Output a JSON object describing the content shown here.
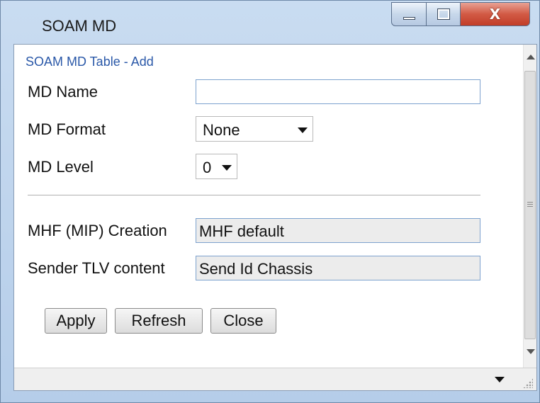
{
  "window": {
    "title": "SOAM MD",
    "controls": {
      "minimize": "minimize",
      "maximize": "maximize",
      "close": "X"
    }
  },
  "form": {
    "section_title": "SOAM MD Table - Add",
    "md_name": {
      "label": "MD Name",
      "value": ""
    },
    "md_format": {
      "label": "MD Format",
      "selected": "None"
    },
    "md_level": {
      "label": "MD Level",
      "selected": "0"
    },
    "mhf_creation": {
      "label": "MHF (MIP) Creation",
      "value": "MHF default"
    },
    "sender_tlv": {
      "label": "Sender TLV content",
      "value": "Send Id Chassis"
    }
  },
  "buttons": {
    "apply": "Apply",
    "refresh": "Refresh",
    "close": "Close"
  },
  "icons": [
    "minimize-icon",
    "maximize-icon",
    "close-icon",
    "chevron-down-icon",
    "scroll-up-icon",
    "scroll-down-icon",
    "resize-grip-icon"
  ],
  "colors": {
    "title_bar": "#c9dcf1",
    "close_button": "#d25a45",
    "section_title": "#2a58a8",
    "input_border": "#7da2ce",
    "readonly_bg": "#ececec"
  }
}
